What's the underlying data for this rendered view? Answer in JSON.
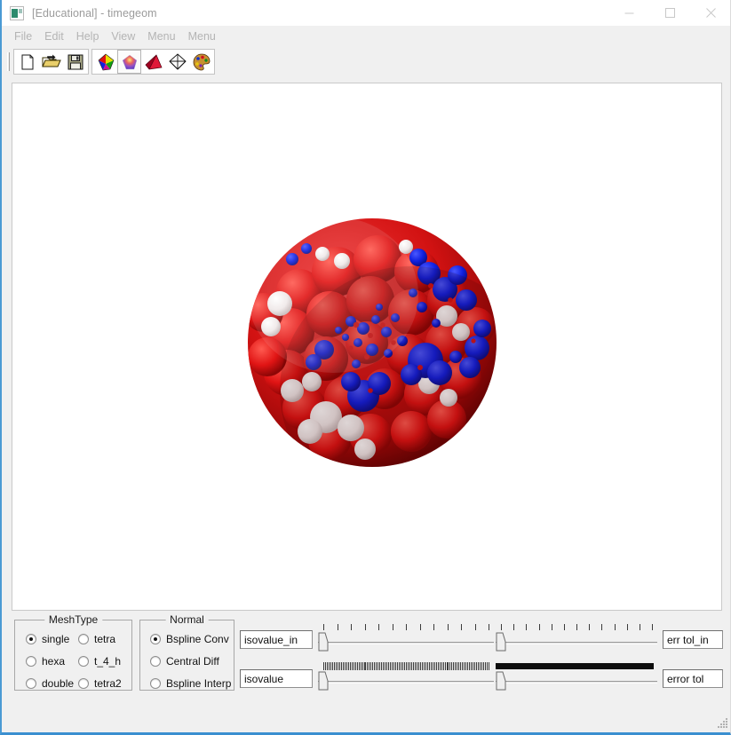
{
  "window": {
    "title": "[Educational] - timegeom",
    "icon": "app-icon",
    "controls": {
      "minimize": "minimize-icon",
      "maximize": "maximize-icon",
      "close": "close-icon"
    }
  },
  "menubar": {
    "items": [
      {
        "label": "File"
      },
      {
        "label": "Edit"
      },
      {
        "label": "Help"
      },
      {
        "label": "View"
      },
      {
        "label": "Menu"
      },
      {
        "label": "Menu"
      }
    ]
  },
  "toolbar": {
    "groups": [
      {
        "buttons": [
          {
            "name": "new-file-icon",
            "pressed": false
          },
          {
            "name": "open-folder-icon",
            "pressed": false
          },
          {
            "name": "save-floppy-icon",
            "pressed": false
          }
        ]
      },
      {
        "buttons": [
          {
            "name": "tetra-color-mesh-icon",
            "pressed": false
          },
          {
            "name": "smooth-shaded-mesh-icon",
            "pressed": true
          },
          {
            "name": "red-pyramid-icon",
            "pressed": false
          },
          {
            "name": "wireframe-octahedron-icon",
            "pressed": false
          },
          {
            "name": "color-palette-icon",
            "pressed": false
          }
        ]
      }
    ]
  },
  "viewport": {
    "label": "3d-render-view",
    "content": "molecular-surface",
    "background": "#ffffff",
    "surface_colors": {
      "positive": "#0a18d2",
      "negative": "#d41010",
      "neutral": "#f2eeee"
    }
  },
  "panel": {
    "mesh_type": {
      "title": "MeshType",
      "options": [
        {
          "label": "single",
          "selected": true
        },
        {
          "label": "tetra",
          "selected": false
        },
        {
          "label": "hexa",
          "selected": false
        },
        {
          "label": "t_4_h",
          "selected": false
        },
        {
          "label": "double",
          "selected": false
        },
        {
          "label": "tetra2",
          "selected": false
        }
      ]
    },
    "normal": {
      "title": "Normal",
      "options": [
        {
          "label": "Bspline Conv",
          "selected": true
        },
        {
          "label": "Central Diff",
          "selected": false
        },
        {
          "label": "Bspline Interp",
          "selected": false
        }
      ]
    },
    "fields": {
      "isovalue_in": "isovalue_in",
      "isovalue": "isovalue",
      "err_tol_in": "err tol_in",
      "error_tol": "error tol"
    },
    "sliders": [
      {
        "name": "isovalue-in-slider-left",
        "value_pos": 0,
        "tick_count": 13,
        "dense": false
      },
      {
        "name": "err-tol-in-slider-right",
        "value_pos": 0,
        "tick_count": 13,
        "dense": false
      },
      {
        "name": "isovalue-slider-left",
        "value_pos": 0,
        "tick_count": 95,
        "dense": true
      },
      {
        "name": "error-tol-slider-right",
        "value_pos": 0,
        "tick_count": 2,
        "dense": false
      }
    ]
  }
}
